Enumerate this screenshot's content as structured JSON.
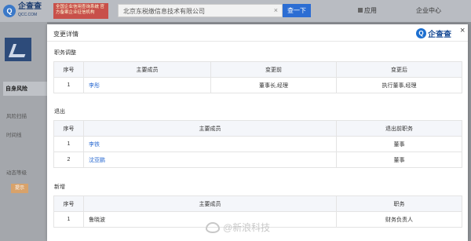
{
  "header": {
    "logo_text": "企查查",
    "logo_sub": "QCC.COM",
    "promo_text": "全国企业信用查询系统 官方备案企业征信机构",
    "search_value": "北京东税缴信息技术有限公司",
    "search_button": "查一下",
    "nav_apps": "应用",
    "nav_center": "企业中心"
  },
  "sidebar": {
    "tab_label": "自身风险",
    "items": [
      "风险扫描",
      "时间线",
      "动态等级"
    ],
    "badge": "提示"
  },
  "modal": {
    "title": "变更详情",
    "logo_text": "企查查",
    "close": "×",
    "sections": [
      {
        "title": "职务调整",
        "headers": [
          "序号",
          "主要成员",
          "变更前",
          "变更后"
        ],
        "rows": [
          {
            "no": "1",
            "member": "李彤",
            "before": "董事长,经理",
            "after": "执行董事,经理"
          }
        ]
      },
      {
        "title": "退出",
        "headers": [
          "序号",
          "主要成员",
          "退出前职务"
        ],
        "rows": [
          {
            "no": "1",
            "member": "李铁",
            "role": "董事"
          },
          {
            "no": "2",
            "member": "沈亚鹏",
            "role": "董事"
          }
        ]
      },
      {
        "title": "新增",
        "headers": [
          "序号",
          "主要成员",
          "职务"
        ],
        "rows": [
          {
            "no": "1",
            "member": "鲁晓波",
            "role": "财务负责人"
          }
        ]
      }
    ]
  },
  "watermark": "@新浪科技"
}
